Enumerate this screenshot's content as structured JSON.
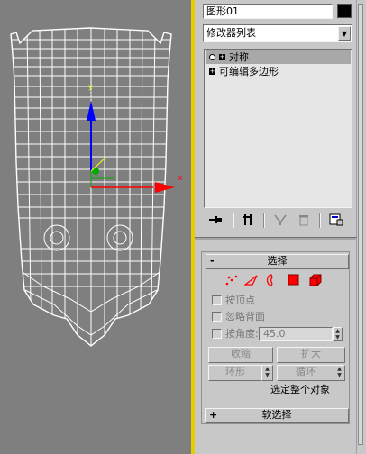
{
  "object_name": "图形01",
  "object_color": "#000000",
  "modifier_list": {
    "selected": "修改器列表"
  },
  "stack": {
    "items": [
      {
        "label": "对称",
        "selected": true,
        "expand": "+"
      },
      {
        "label": "可编辑多边形",
        "selected": false,
        "expand": "+"
      }
    ]
  },
  "toolbar": {
    "icons": [
      "pin-stack-icon",
      "show-end-result-icon",
      "make-unique-icon",
      "remove-modifier-icon",
      "configure-modifier-sets-icon"
    ]
  },
  "selection_rollout": {
    "sign": "-",
    "title": "选择",
    "levels": [
      "vertex-icon",
      "edge-icon",
      "border-icon",
      "polygon-icon",
      "element-icon"
    ],
    "by_vertex": "按顶点",
    "ignore_backfacing": "忽略背面",
    "by_angle": "按角度:",
    "angle_value": "45.0",
    "shrink": "收缩",
    "grow": "扩大",
    "ring": "环形",
    "loop": "循环",
    "status": "选定整个对象"
  },
  "soft_selection_rollout": {
    "sign": "+",
    "title": "软选择"
  },
  "gizmo": {
    "axis_x_label": "x",
    "axis_y_label": "y"
  },
  "colors": {
    "accent_yellow": "#e3cf00",
    "viewport_bg": "#7f7f7f",
    "selected_item": "#a8a8a8",
    "face_red": "#ff0000",
    "gizmo_blue": "#0000ff",
    "gizmo_green": "#00aa00"
  }
}
